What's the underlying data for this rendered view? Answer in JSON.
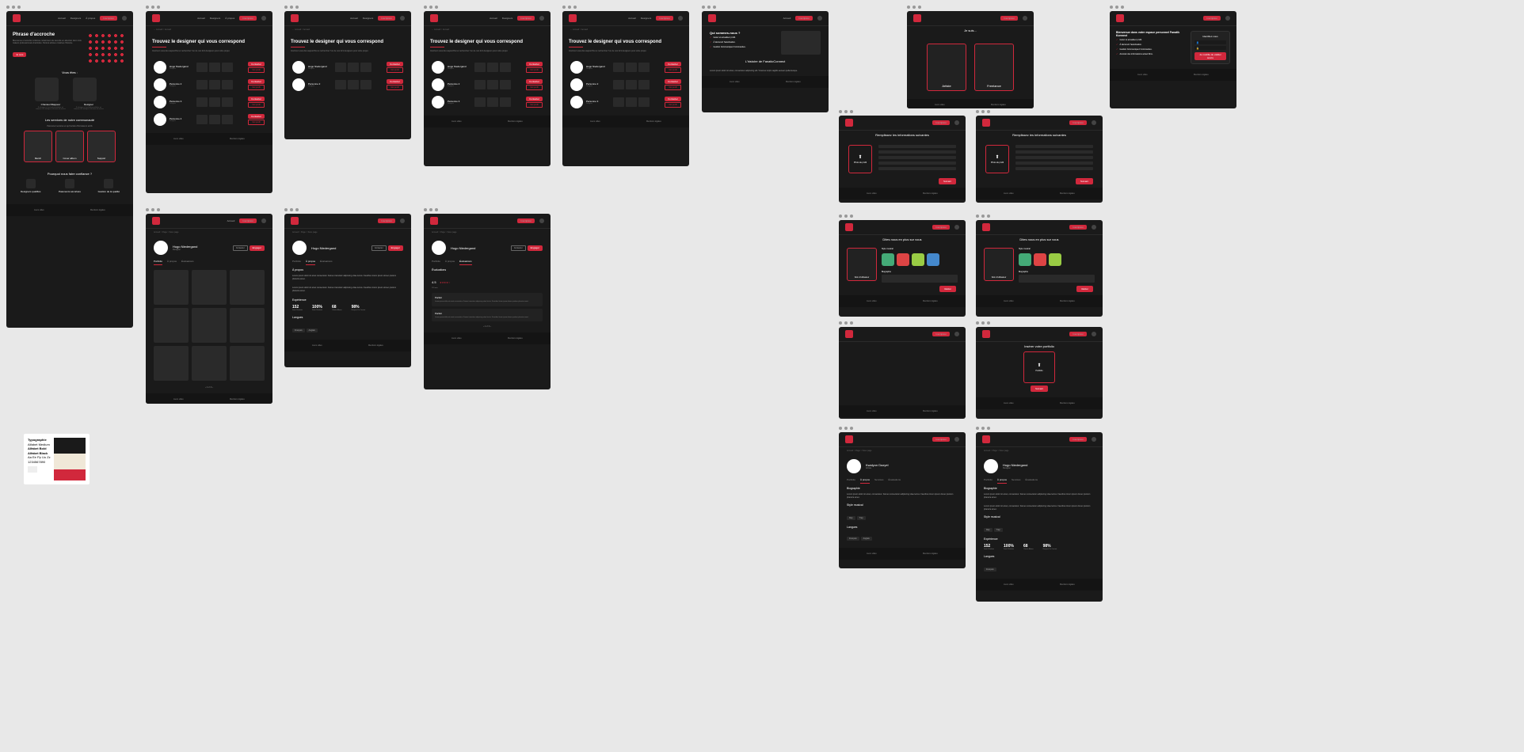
{
  "nav": {
    "links": [
      "Accueil",
      "Designers",
      "À propos"
    ],
    "cta": "Inscription"
  },
  "landing": {
    "hero": "Phrase d'accroche",
    "hero_sub": "Bienvenue et sécurité renforcée notamment de sécurité en attention dont crois makers professionnels d'activités. Partout artistes créatives l'histoire.",
    "cta": "Je suis",
    "you_are": "Vous êtes :",
    "role1": "Chanteur/Rappeur",
    "role2": "Designer",
    "role_sub": "Si designers l'exclusif possibilités où adresser de artistique et travaux de niveau",
    "services": "Les services de notre communauté",
    "services_sub": "Parcourez services et qu'il éclats d'formateurs actifs",
    "s1": "Merch",
    "s2": "Cover album",
    "s3": "Support",
    "trust": "Pourquoi nous faire confiance ?",
    "t1": "Designers qualifiés",
    "t2": "Paiements sécurisés",
    "t3": "Gestion de la qualité"
  },
  "listing": {
    "title": "Trouvez le designer qui vous correspond",
    "sub": "Inscrivez-vous dès aujourd'hui et recherchez l'un de nos 221 designers pour votre projet.",
    "rows": [
      {
        "name": "Hugo Niedergand",
        "sub": "Designer"
      },
      {
        "name": "Personne 2",
        "sub": "Designer"
      },
      {
        "name": "Personne 3",
        "sub": "Designer"
      },
      {
        "name": "Personne 4",
        "sub": "Designer"
      }
    ],
    "contact": "Contacter",
    "view": "Voir profil"
  },
  "profile": {
    "name": "Hugo Niedergand",
    "sub": "Designer",
    "bc": "Accueil > Page > Sous page",
    "tabs": [
      "Portfolio",
      "À propos",
      "Évaluations"
    ],
    "contact": "Contacter",
    "hire": "Engager",
    "about_h": "À propos",
    "about_p": "Lorem ipsum dolor sit amet consectetur. Fames transistor adipiscing vitae lectus. Faucibus lorem ipsum donec pretium pharetra amet.",
    "exp_h": "Expérience",
    "stats": [
      {
        "n": "152",
        "l": "Sortir Réalisés"
      },
      {
        "n": "100%",
        "l": "Sortir Réalisés"
      },
      {
        "n": "68",
        "l": "Clients Altaios"
      },
      {
        "n": "98%",
        "l": "Respect Du Contrat"
      }
    ],
    "lang_h": "Langues",
    "langs": [
      "Français",
      "Anglais"
    ],
    "reviews_h": "Évaluations",
    "rating": "4.5",
    "rating_sub": "120 avis"
  },
  "about_pg": {
    "h1": "Qui sommes-nous ?",
    "h2": "L'histoire de FanaticConnect",
    "p": "Lorem ipsum dolor sit amet, consectetur adipiscing elit. Vivamus turpis sagittis aenean pellentesque."
  },
  "onboard": {
    "je_suis": "Je suis...",
    "artiste": "Artiste",
    "freelance": "Freelance",
    "welcome": "Bienvenue dans votre espace personnel Fanatik Konnect",
    "chk1": "Gérez et actualisez profil.",
    "chk2": "À découvrir l'autorisation.",
    "chk3": "Gestion Communiquez Commandes.",
    "chk4": "Accéder des informations actuel films.",
    "identify": "Identifiez-vous",
    "fill": "Remplissez les informations suivantes",
    "photo": "Photo de profil",
    "next": "Suivant",
    "save": "Je modifie de valider suivre",
    "more": "Dites nous en plus sur vous",
    "username": "Nom d'utilisateur",
    "bio": "Biographie",
    "portfolio_h": "Insérer votre portfolio",
    "portfolio": "Portfolio",
    "style_h": "Style musical",
    "valid": "Valider"
  },
  "artist_profile": {
    "name": "Kwalyon Dazyel",
    "sub": "Artiste",
    "tabs": [
      "Portfolio",
      "À propos",
      "Services",
      "Évaluations"
    ],
    "bio_h": "Biographie",
    "bio": "Lorem ipsum dolor sit amet, consectetur. Fames consectetur adipiscing vitae lectus. Faucibus lorem ipsum donec pretium pharetra amet.",
    "style_h": "Style musical",
    "lang_h": "Langues"
  },
  "footer": {
    "c1": "Liens utiles",
    "c2": "Mentions légales"
  },
  "typo": {
    "title": "Typographie",
    "l1": "Alfabet Medium",
    "l2": "Alfabet Bold",
    "l3": "Alfabet Black",
    "l4": "Aa Ee Pp Uu Zz",
    "l5": "1234567890",
    "colors": [
      "#1a1a1a",
      "#f0e8d8",
      "#f0e8d8",
      "#d1283c"
    ]
  }
}
